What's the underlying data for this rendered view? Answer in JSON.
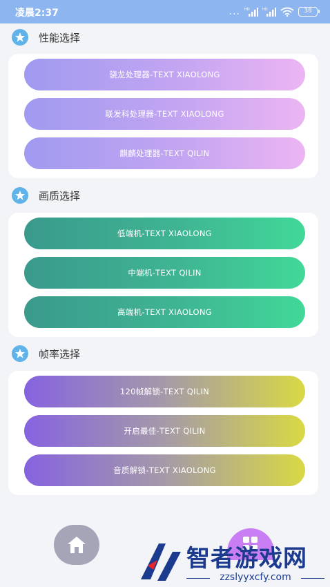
{
  "status_bar": {
    "time": "凌晨2:37",
    "dots": "...",
    "network_1": "HD",
    "network_2": "HD",
    "battery": "38"
  },
  "sections": [
    {
      "title": "性能选择",
      "buttons": [
        "骁龙处理器-TEXT XIAOLONG",
        "联发科处理器-TEXT XIAOLONG",
        "麒麟处理器-TEXT QILIN"
      ]
    },
    {
      "title": "画质选择",
      "buttons": [
        "低端机-TEXT XIAOLONG",
        "中端机-TEXT QILIN",
        "高端机-TEXT XIAOLONG"
      ]
    },
    {
      "title": "帧率选择",
      "buttons": [
        "120帧解锁-TEXT QILIN",
        "开启最佳-TEXT QILIN",
        "音质解锁-TEXT XIAOLONG"
      ]
    }
  ],
  "bottom_nav": {
    "home_icon": "home-icon",
    "apps_icon": "apps-icon"
  },
  "watermark": {
    "title": "智者游戏网",
    "url": "zzslyyxcfy.com"
  },
  "colors": {
    "status_bar": "#8db5f0",
    "star_icon": "#5fb3e8",
    "purple_gradient": [
      "#a09af0",
      "#ecb5f2"
    ],
    "green_gradient": [
      "#3a9a8c",
      "#41d898"
    ],
    "yellow_gradient": [
      "#8663e0",
      "#d9d944"
    ]
  }
}
